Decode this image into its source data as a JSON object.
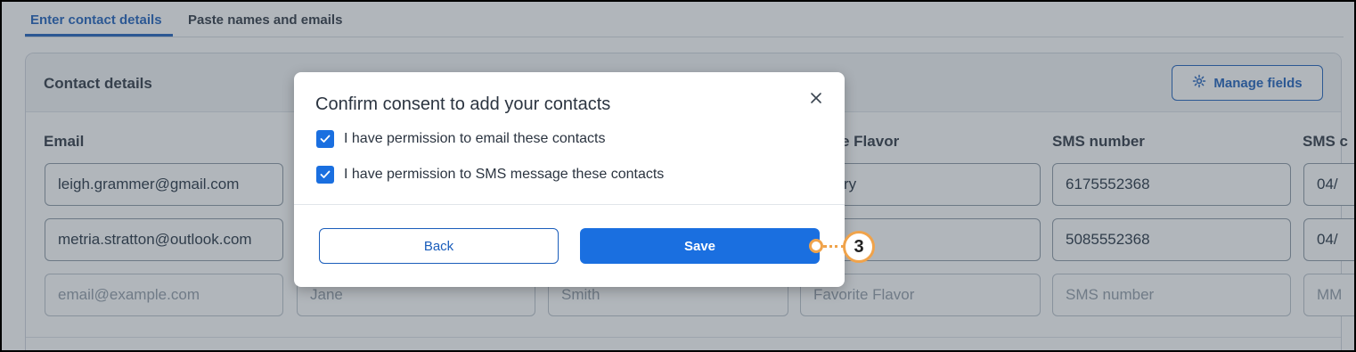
{
  "tabs": [
    {
      "label": "Enter contact details",
      "active": true
    },
    {
      "label": "Paste names and emails",
      "active": false
    }
  ],
  "card": {
    "title": "Contact details",
    "manage_fields_label": "Manage fields",
    "columns": [
      "Email",
      "rite Flavor",
      "SMS number",
      "SMS c"
    ],
    "rows": [
      {
        "email": "leigh.grammer@gmail.com",
        "flavor": "oberry",
        "sms": "6175552368",
        "sms_date": "04/"
      },
      {
        "email": "metria.stratton@outlook.com",
        "flavor": "",
        "sms": "5085552368",
        "sms_date": "04/"
      }
    ],
    "placeholders": {
      "email": "email@example.com",
      "first": "Jane",
      "last": "Smith",
      "flavor": "Favorite Flavor",
      "sms": "SMS number",
      "sms_date": "MM"
    }
  },
  "modal": {
    "title": "Confirm consent to add your contacts",
    "close_icon": "close-icon",
    "checkboxes": [
      {
        "label": "I have permission to email these contacts",
        "checked": true
      },
      {
        "label": "I have permission to SMS message these contacts",
        "checked": true
      }
    ],
    "back_label": "Back",
    "save_label": "Save"
  },
  "callout": {
    "number": "3",
    "color": "#f0a34b"
  },
  "colors": {
    "accent": "#1a6fe0",
    "link": "#1a5dbb"
  }
}
